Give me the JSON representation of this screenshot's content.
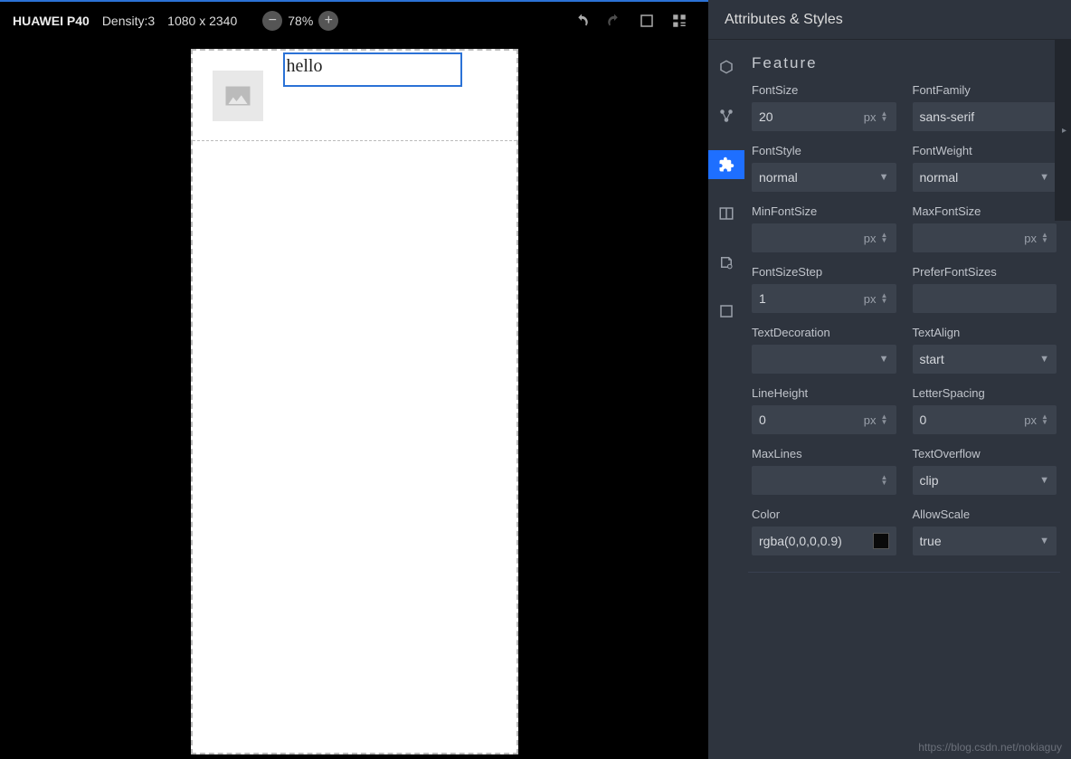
{
  "top": {
    "device": "HUAWEI P40",
    "density": "Density:3",
    "resolution": "1080 x 2340",
    "zoom": "78%"
  },
  "canvas": {
    "selected_text": "hello"
  },
  "panel": {
    "title": "Attributes & Styles",
    "section": "Feature",
    "fields": {
      "fontSize": {
        "label": "FontSize",
        "value": "20",
        "unit": "px"
      },
      "fontFamily": {
        "label": "FontFamily",
        "value": "sans-serif"
      },
      "fontStyle": {
        "label": "FontStyle",
        "value": "normal"
      },
      "fontWeight": {
        "label": "FontWeight",
        "value": "normal"
      },
      "minFontSize": {
        "label": "MinFontSize",
        "value": "",
        "unit": "px"
      },
      "maxFontSize": {
        "label": "MaxFontSize",
        "value": "",
        "unit": "px"
      },
      "fontSizeStep": {
        "label": "FontSizeStep",
        "value": "1",
        "unit": "px"
      },
      "preferFontSizes": {
        "label": "PreferFontSizes",
        "value": ""
      },
      "textDecoration": {
        "label": "TextDecoration",
        "value": ""
      },
      "textAlign": {
        "label": "TextAlign",
        "value": "start"
      },
      "lineHeight": {
        "label": "LineHeight",
        "value": "0",
        "unit": "px"
      },
      "letterSpacing": {
        "label": "LetterSpacing",
        "value": "0",
        "unit": "px"
      },
      "maxLines": {
        "label": "MaxLines",
        "value": ""
      },
      "textOverflow": {
        "label": "TextOverflow",
        "value": "clip"
      },
      "color": {
        "label": "Color",
        "value": "rgba(0,0,0,0.9)"
      },
      "allowScale": {
        "label": "AllowScale",
        "value": "true"
      }
    }
  },
  "watermark": "https://blog.csdn.net/nokiaguy"
}
